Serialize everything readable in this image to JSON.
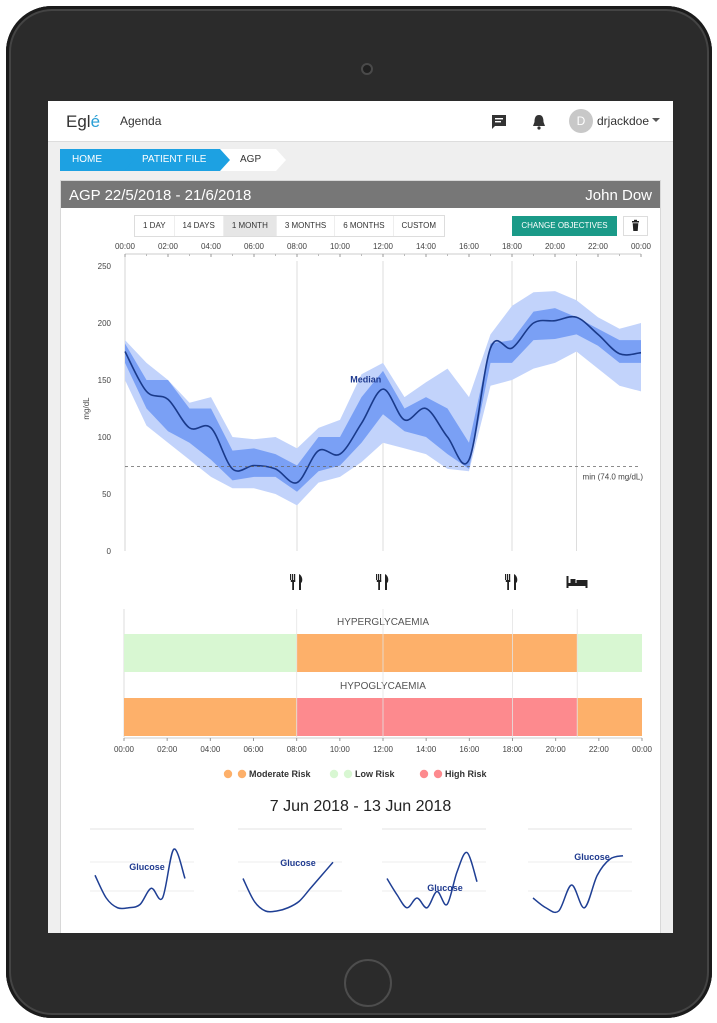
{
  "app": {
    "logo_main": "Egl",
    "logo_accent": "é",
    "nav_agenda": "Agenda",
    "username": "drjackdoe",
    "avatar_initial": "D"
  },
  "breadcrumb": {
    "home": "HOME",
    "file": "PATIENT FILE",
    "current": "AGP"
  },
  "panel": {
    "title": "AGP 22/5/2018 - 21/6/2018",
    "patient": "John Dow"
  },
  "range_buttons": [
    "1 DAY",
    "14 DAYS",
    "1 MONTH",
    "3 MONTHS",
    "6 MONTHS",
    "CUSTOM"
  ],
  "active_range": "1 MONTH",
  "change_objectives": "CHANGE OBJECTIVES",
  "icons": {
    "chat": "chat-icon",
    "bell": "bell-icon",
    "trash": "trash-icon",
    "meal": "meal-icon",
    "bed": "bed-icon"
  },
  "colors": {
    "brand": "#1da1e2",
    "teal": "#1a9a88",
    "median": "#1a3a8a",
    "iqr": "#7aa0f5",
    "outer": "#c2d3fb",
    "moderate": "#fdb06a",
    "low": "#d8f7d2",
    "high": "#fd8a8e"
  },
  "chart_data": [
    {
      "type": "area",
      "ylabel": "mg/dL",
      "ylim": [
        0,
        250
      ],
      "y_ticks": [
        0,
        50,
        100,
        150,
        200,
        250
      ],
      "x_ticks": [
        "00:00",
        "02:00",
        "04:00",
        "06:00",
        "08:00",
        "10:00",
        "12:00",
        "14:00",
        "16:00",
        "18:00",
        "20:00",
        "22:00",
        "00:00"
      ],
      "x": [
        0,
        1,
        2,
        3,
        4,
        5,
        6,
        7,
        8,
        9,
        10,
        11,
        12,
        13,
        14,
        15,
        16,
        17,
        18,
        19,
        20,
        21,
        22,
        23,
        24
      ],
      "series": [
        {
          "name": "Median",
          "values": [
            175,
            140,
            133,
            108,
            108,
            72,
            75,
            72,
            60,
            88,
            85,
            112,
            142,
            115,
            125,
            100,
            80,
            178,
            178,
            200,
            202,
            205,
            190,
            173,
            174
          ]
        }
      ],
      "percentile_25_75": {
        "low": [
          165,
          125,
          105,
          95,
          80,
          62,
          65,
          65,
          52,
          70,
          75,
          95,
          120,
          105,
          100,
          85,
          72,
          165,
          165,
          185,
          186,
          190,
          180,
          165,
          165
        ],
        "high": [
          182,
          150,
          150,
          125,
          125,
          88,
          90,
          85,
          75,
          100,
          100,
          135,
          158,
          125,
          135,
          125,
          95,
          182,
          185,
          210,
          213,
          205,
          195,
          185,
          185
        ]
      },
      "percentile_10_90": {
        "low": [
          150,
          110,
          95,
          80,
          65,
          55,
          55,
          50,
          40,
          60,
          65,
          78,
          95,
          90,
          85,
          72,
          70,
          145,
          150,
          160,
          165,
          175,
          160,
          145,
          140
        ],
        "high": [
          185,
          165,
          150,
          130,
          135,
          100,
          98,
          100,
          90,
          108,
          115,
          155,
          165,
          135,
          148,
          160,
          135,
          190,
          215,
          227,
          228,
          220,
          205,
          195,
          200
        ]
      },
      "threshold": {
        "value": 74,
        "label": "min (74.0 mg/dL)"
      },
      "annotation": "Median",
      "markers": [
        {
          "x": 8,
          "icon": "meal-icon"
        },
        {
          "x": 12,
          "icon": "meal-icon"
        },
        {
          "x": 18,
          "icon": "meal-icon"
        },
        {
          "x": 21,
          "icon": "bed-icon"
        }
      ]
    },
    {
      "type": "risk_bands",
      "rows": [
        {
          "label": "HYPERGLYCAEMIA",
          "segments": [
            {
              "from": 0,
              "to": 8,
              "risk": "low"
            },
            {
              "from": 8,
              "to": 21,
              "risk": "moderate"
            },
            {
              "from": 21,
              "to": 24,
              "risk": "low"
            }
          ]
        },
        {
          "label": "HYPOGLYCAEMIA",
          "segments": [
            {
              "from": 0,
              "to": 8,
              "risk": "moderate"
            },
            {
              "from": 8,
              "to": 21,
              "risk": "high"
            },
            {
              "from": 21,
              "to": 24,
              "risk": "moderate"
            }
          ]
        }
      ],
      "x_ticks": [
        "00:00",
        "02:00",
        "04:00",
        "06:00",
        "08:00",
        "10:00",
        "12:00",
        "14:00",
        "16:00",
        "18:00",
        "20:00",
        "22:00",
        "00:00"
      ],
      "legend": [
        {
          "label": "Moderate Risk",
          "color": "#fdb06a"
        },
        {
          "label": "Low Risk",
          "color": "#d8f7d2"
        },
        {
          "label": "High Risk",
          "color": "#fd8a8e"
        }
      ]
    },
    {
      "type": "line",
      "title": "7 Jun 2018 - 13 Jun 2018",
      "series": [
        {
          "name": "Glucose",
          "values": [
            0.55,
            0.2,
            0.05,
            0.05,
            0.1,
            0.35,
            0.2,
            0.95,
            0.5
          ]
        },
        {
          "name": "Glucose",
          "values": [
            0.5,
            0.15,
            0.0,
            0.0,
            0.05,
            0.15,
            0.35,
            0.55,
            0.75
          ]
        },
        {
          "name": "Glucose",
          "values": [
            0.5,
            0.25,
            0.05,
            0.2,
            0.05,
            0.3,
            0.1,
            0.6,
            0.9,
            0.45
          ]
        },
        {
          "name": "Glucose",
          "values": [
            0.2,
            0.05,
            0.0,
            0.4,
            0.05,
            0.55,
            0.8,
            0.85
          ]
        }
      ]
    }
  ]
}
